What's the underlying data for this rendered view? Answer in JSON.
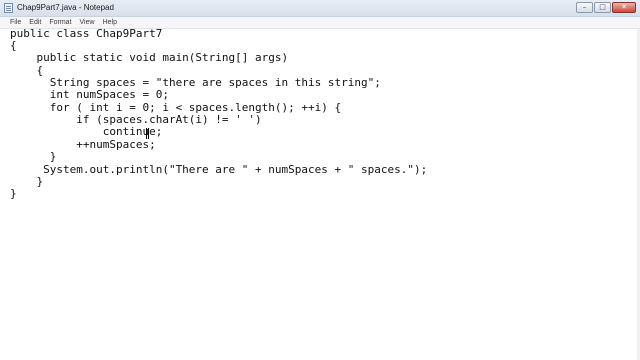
{
  "window": {
    "title": "Chap9Part7.java - Notepad",
    "buttons": {
      "minimize": "–",
      "maximize": "□",
      "close": "✕"
    }
  },
  "menu": {
    "items": [
      "File",
      "Edit",
      "Format",
      "View",
      "Help"
    ]
  },
  "editor": {
    "lines": [
      "public class Chap9Part7",
      "{",
      "    public static void main(String[] args)",
      "    {",
      "      String spaces = \"there are spaces in this string\";",
      "      int numSpaces = 0;",
      "      for ( int i = 0; i < spaces.length(); ++i) {",
      "          if (spaces.charAt(i) != ' ')",
      "              continue;",
      "          ++numSpaces;",
      "      }",
      "     System.out.println(\"There are \" + numSpaces + \" spaces.\");",
      "    }",
      "}"
    ]
  }
}
